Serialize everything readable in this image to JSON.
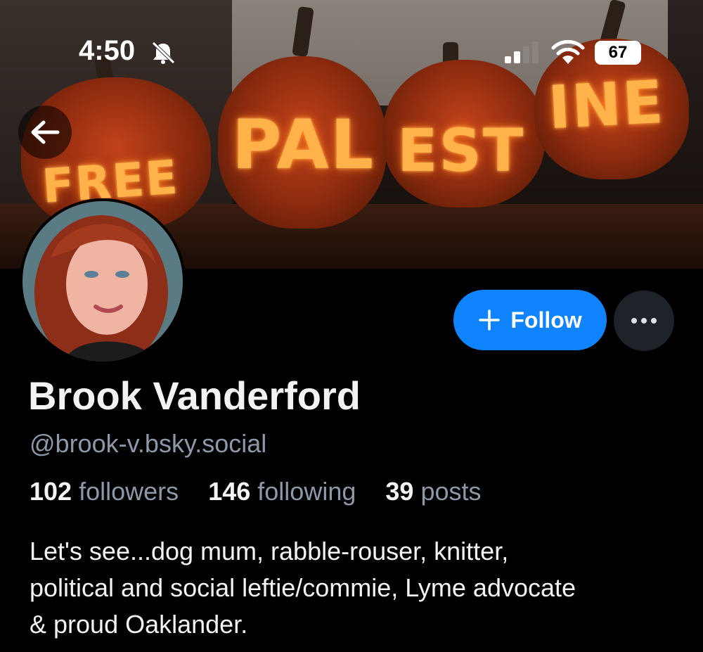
{
  "status_bar": {
    "time": "4:50",
    "battery": "67",
    "bell_icon": "bell-slash-icon",
    "signal_icon": "cellular-signal-icon",
    "wifi_icon": "wifi-icon"
  },
  "banner": {
    "carved_words": [
      "FREE",
      "PAL",
      "EST",
      "INE"
    ]
  },
  "nav": {
    "back_icon": "arrow-left-icon"
  },
  "actions": {
    "follow_label": "Follow",
    "follow_icon": "plus-icon",
    "more_icon": "ellipsis-icon",
    "accent_color": "#1083fe"
  },
  "profile": {
    "display_name": "Brook Vanderford",
    "handle": "@brook-v.bsky.social",
    "followers_count": "102",
    "followers_label": "followers",
    "following_count": "146",
    "following_label": "following",
    "posts_count": "39",
    "posts_label": "posts",
    "bio_lines": [
      "Let's see...dog mum, rabble-rouser, knitter,",
      "political and social leftie/commie, Lyme advocate",
      "& proud Oaklander."
    ]
  }
}
